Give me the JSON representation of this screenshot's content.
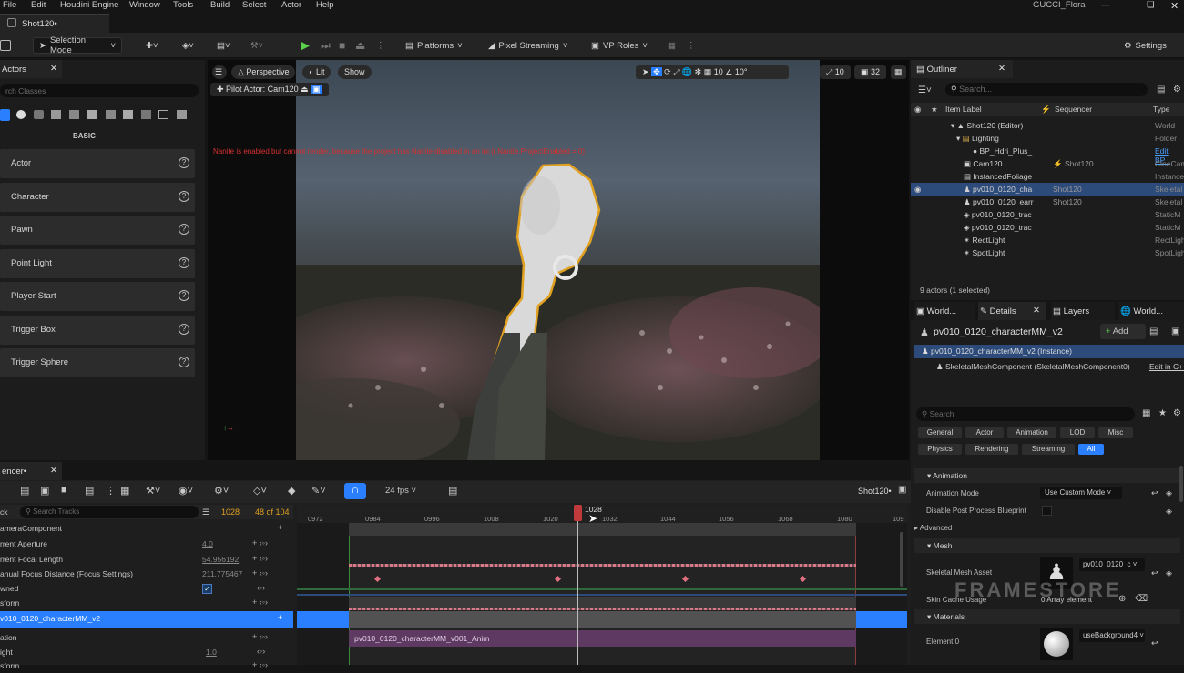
{
  "menu": [
    "File",
    "Edit",
    "Houdini Engine",
    "Window",
    "Tools",
    "Build",
    "Select",
    "Actor",
    "Help"
  ],
  "project_name": "GUCCI_Flora",
  "doc_tab": "Shot120•",
  "toolbar": {
    "selection_mode": "Selection Mode",
    "platforms": "Platforms",
    "pixel_streaming": "Pixel Streaming",
    "vp_roles": "VP Roles",
    "settings": "Settings"
  },
  "actors_panel": {
    "tab": "Actors",
    "search_placeholder": "rch Classes",
    "category": "BASIC",
    "items": [
      "Actor",
      "Character",
      "Pawn",
      "Point Light",
      "Player Start",
      "Trigger Box",
      "Trigger Sphere"
    ]
  },
  "viewport": {
    "perspective": "Perspective",
    "lit": "Lit",
    "show": "Show",
    "pilot_actor": "Pilot Actor: Cam120",
    "warning": "Nanite is enabled but cannot render, because the project has Nanite disabled in an ini (r.Nanite.ProjectEnabled = 0)",
    "grid_value": "10",
    "angle_value": "10°",
    "scale_value": "10",
    "camera_speed": "32"
  },
  "outliner": {
    "tab": "Outliner",
    "search_placeholder": "Search...",
    "col_label": "Item Label",
    "col_sequencer": "Sequencer",
    "col_type": "Type",
    "rows": [
      {
        "name": "Shot120 (Editor)",
        "seq": "",
        "type": "World"
      },
      {
        "name": "Lighting",
        "seq": "",
        "type": "Folder"
      },
      {
        "name": "BP_Hdri_Plus_",
        "seq": "",
        "type": "Edit BP_"
      },
      {
        "name": "Cam120",
        "seq": "Shot120",
        "type": "CineCam"
      },
      {
        "name": "InstancedFoliage",
        "seq": "",
        "type": "Instance"
      },
      {
        "name": "pv010_0120_cha",
        "seq": "Shot120",
        "type": "Skeletal"
      },
      {
        "name": "pv010_0120_earr",
        "seq": "Shot120",
        "type": "Skeletal"
      },
      {
        "name": "pv010_0120_trac",
        "seq": "",
        "type": "StaticM"
      },
      {
        "name": "pv010_0120_trac",
        "seq": "",
        "type": "StaticM"
      },
      {
        "name": "RectLight",
        "seq": "",
        "type": "RectLigh"
      },
      {
        "name": "SpotLight",
        "seq": "",
        "type": "SpotLigh"
      }
    ],
    "footer": "9 actors (1 selected)"
  },
  "details": {
    "tabs": [
      "World...",
      "Details",
      "Layers",
      "World..."
    ],
    "actor_name": "pv010_0120_characterMM_v2",
    "add_label": "Add",
    "instance": "pv010_0120_characterMM_v2 (Instance)",
    "component": "SkeletalMeshComponent (SkeletalMeshComponent0)",
    "edit_link": "Edit in C++",
    "search_placeholder": "Search",
    "filters_row1": [
      "General",
      "Actor",
      "Animation",
      "LOD",
      "Misc"
    ],
    "filters_row2": [
      "Physics",
      "Rendering",
      "Streaming",
      "All"
    ],
    "sec_animation": "Animation",
    "animation_mode_label": "Animation Mode",
    "animation_mode_value": "Use Custom Mode",
    "disable_pp_label": "Disable Post Process Blueprint",
    "advanced": "Advanced",
    "sec_mesh": "Mesh",
    "skeletal_mesh_label": "Skeletal Mesh Asset",
    "skeletal_mesh_value": "pv010_0120_c",
    "skin_cache_label": "Skin Cache Usage",
    "skin_cache_value": "0 Array element",
    "sec_materials": "Materials",
    "element0_label": "Element 0",
    "element0_value": "useBackground4",
    "watermark": "FRAMESTORE"
  },
  "sequencer": {
    "tab": "encer•",
    "fps": "24 fps",
    "shot": "Shot120•",
    "track_label": "ck",
    "search_placeholder": "Search Tracks",
    "current_frame": "1028",
    "frame_count": "48 of 104",
    "playhead_label": "1028",
    "ticks": [
      "0972",
      "0984",
      "0996",
      "1008",
      "1020",
      "1032",
      "1044",
      "1056",
      "1068",
      "1080",
      "109"
    ],
    "tracks": [
      {
        "name": "ameraComponent",
        "value": ""
      },
      {
        "name": "rrent Aperture",
        "value": "4.0"
      },
      {
        "name": "rrent Focal Length",
        "value": "54.956192"
      },
      {
        "name": "anual Focus Distance (Focus Settings)",
        "value": "211.775467"
      },
      {
        "name": "wned",
        "value": ""
      },
      {
        "name": "sform",
        "value": ""
      },
      {
        "name": "v010_0120_characterMM_v2",
        "value": ""
      },
      {
        "name": "ation",
        "value": ""
      },
      {
        "name": "ight",
        "value": "1.0"
      },
      {
        "name": "sform",
        "value": ""
      }
    ],
    "anim_clip": "pv010_0120_characterMM_v001_Anim"
  }
}
